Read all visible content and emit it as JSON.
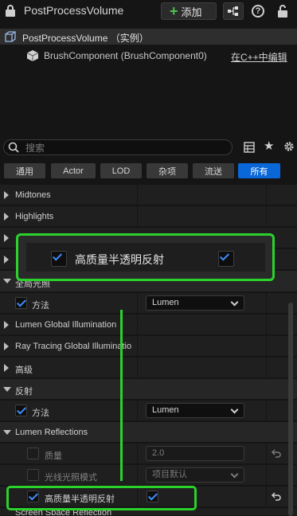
{
  "header": {
    "title": "PostProcessVolume",
    "add_label": "添加"
  },
  "tree": {
    "root_label": "PostProcessVolume （实例）",
    "child_label": "BrushComponent (BrushComponent0)",
    "edit_link": "在C++中编辑"
  },
  "search": {
    "placeholder": "搜索"
  },
  "filters": [
    "通用",
    "Actor",
    "LOD",
    "杂项",
    "流送",
    "所有"
  ],
  "filter_active": "所有",
  "rows": {
    "midtones": "Midtones",
    "highlights": "Highlights",
    "gi_method": "方法",
    "gi_method_value": "Lumen",
    "lumen_gi": "Lumen Global Illumination",
    "rt_gi": "Ray Tracing Global Illuminatio",
    "advanced": "高级",
    "reflections": "反射",
    "refl_method": "方法",
    "refl_method_value": "Lumen",
    "lumen_refl": "Lumen Reflections",
    "quality": "质量",
    "quality_value": "2.0",
    "ray_lighting_mode": "光线光照模式",
    "ray_lighting_value": "项目默认",
    "hq_translucency": "高质量半透明反射",
    "partial_top": "全局光照",
    "partial_bottom": "Screen Space Reflection"
  },
  "zoom": {
    "label": "高质量半透明反射"
  },
  "colors": {
    "accent_blue": "#0a67d8",
    "highlight_green": "#2bd22b",
    "check_blue": "#3d8fff"
  }
}
